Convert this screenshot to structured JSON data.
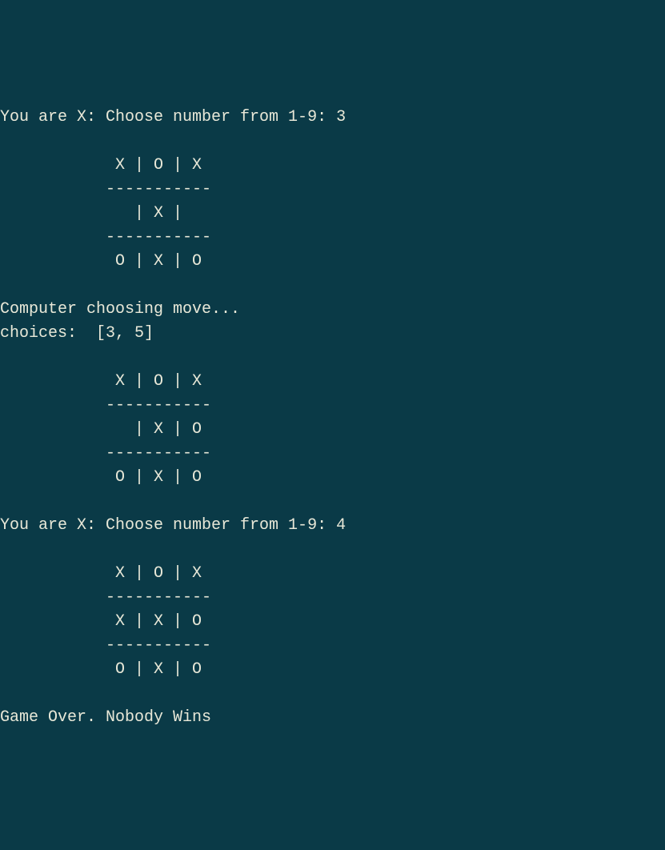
{
  "prompt1": "You are X: Choose number from 1-9: 3",
  "board1": {
    "leadpad": "           ",
    "row1": " X | O | X",
    "sep1": "-----------",
    "row2": "   | X |  ",
    "sep2": "-----------",
    "row3": " O | X | O"
  },
  "computer_msg": "Computer choosing move...",
  "choices_line": "choices:  [3, 5]",
  "board2": {
    "leadpad": "           ",
    "row1": " X | O | X",
    "sep1": "-----------",
    "row2": "   | X | O",
    "sep2": "-----------",
    "row3": " O | X | O"
  },
  "prompt2": "You are X: Choose number from 1-9: 4",
  "board3": {
    "leadpad": "           ",
    "row1": " X | O | X",
    "sep1": "-----------",
    "row2": " X | X | O",
    "sep2": "-----------",
    "row3": " O | X | O"
  },
  "gameover": "Game Over. Nobody Wins"
}
